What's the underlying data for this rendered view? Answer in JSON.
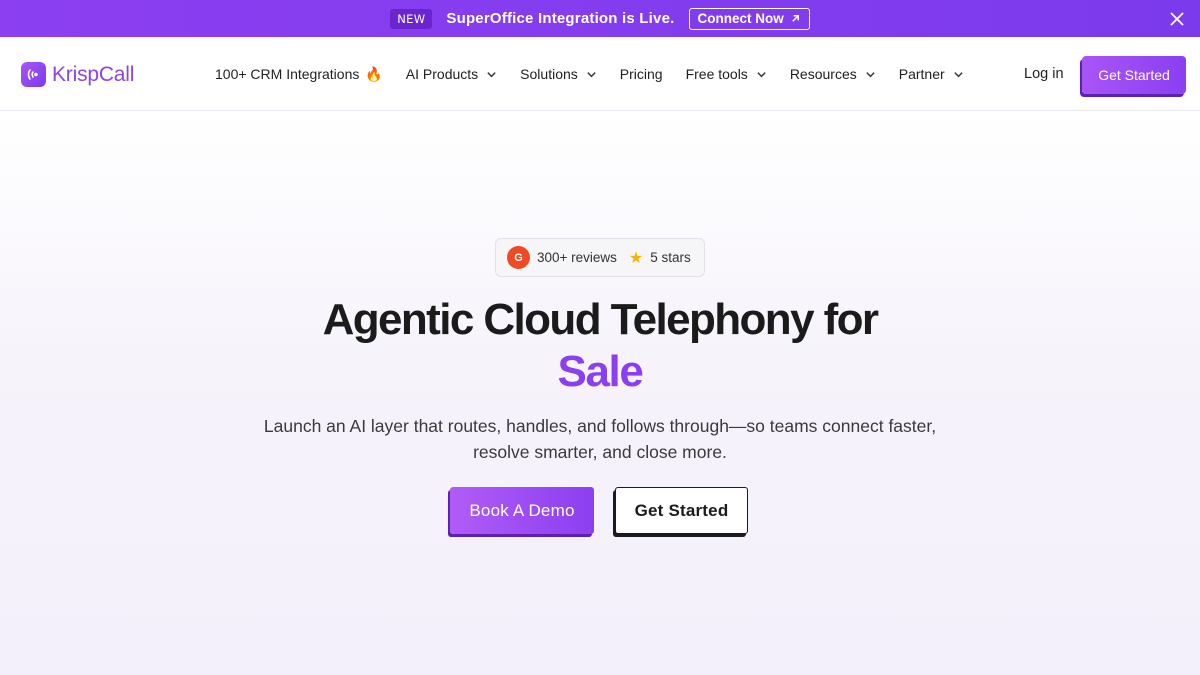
{
  "announcement": {
    "badge": "NEW",
    "text": "SuperOffice Integration is Live.",
    "cta": "Connect Now",
    "cta_icon": "arrow-up-right-icon",
    "close_icon": "close-icon"
  },
  "nav": {
    "logo_text": "KrispCall",
    "items": [
      {
        "label": "100+ CRM Integrations",
        "icon": "🔥",
        "has_dropdown": false
      },
      {
        "label": "AI Products",
        "has_dropdown": true
      },
      {
        "label": "Solutions",
        "has_dropdown": true
      },
      {
        "label": "Pricing",
        "has_dropdown": false
      },
      {
        "label": "Free tools",
        "has_dropdown": true
      },
      {
        "label": "Resources",
        "has_dropdown": true
      },
      {
        "label": "Partner",
        "has_dropdown": true
      }
    ],
    "login": "Log in",
    "cta": "Get Started"
  },
  "hero": {
    "reviews": {
      "g2_label": "G",
      "count_text": "300+ reviews",
      "stars_text": "5 stars"
    },
    "headline": "Agentic Cloud Telephony for",
    "headline_accent": "Sale",
    "subtitle": "Launch an AI layer that routes, handles, and follows through—so teams connect faster, resolve smarter, and close more.",
    "primary_cta": "Book A Demo",
    "secondary_cta": "Get Started"
  },
  "colors": {
    "brand": "#8b3ff0",
    "announce_bg": "#7c3aed",
    "g2": "#ef4a23"
  }
}
